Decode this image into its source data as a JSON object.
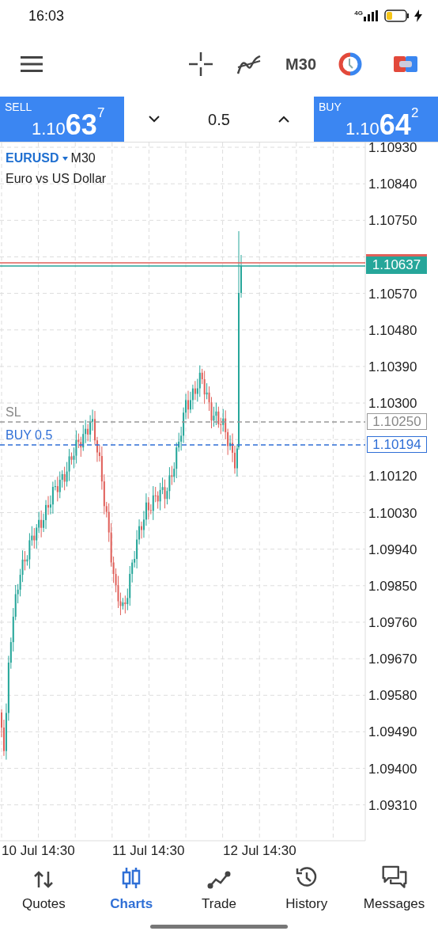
{
  "status_bar": {
    "time": "16:03",
    "network": "4G"
  },
  "toolbar": {
    "timeframe": "M30"
  },
  "trade_panel": {
    "sell": {
      "label": "SELL",
      "price": "1.10**63**$^{7}$"
    },
    "volume": "0.5",
    "buy": {
      "label": "BUY",
      "price": "1.10**64**$^{2}$"
    }
  },
  "chart": {
    "symbol": "EURUSD",
    "timeframe": "M30",
    "description": "Euro vs US Dollar",
    "price_labels": [
      "1.10930",
      "1.10840",
      "1.10750",
      "1.10570",
      "1.10480",
      "1.10390",
      "1.10300",
      "1.10120",
      "1.10030",
      "1.09940",
      "1.09850",
      "1.09760",
      "1.09670",
      "1.09580",
      "1.09490",
      "1.09400",
      "1.09310"
    ],
    "time_labels": [
      "10 Jul 14:30",
      "11 Jul 14:30",
      "12 Jul 14:30"
    ],
    "current_price": "1.10637",
    "levels": [
      {
        "kind": "stop_loss",
        "label": "SL",
        "price": "1.10250"
      },
      {
        "kind": "order",
        "label": "BUY 0.5",
        "price": "1.10194"
      }
    ]
  },
  "nav": [
    {
      "label": "Quotes",
      "selected": false
    },
    {
      "label": "Charts",
      "selected": true
    },
    {
      "label": "Trade",
      "selected": false
    },
    {
      "label": "History",
      "selected": false
    },
    {
      "label": "Messages",
      "selected": false
    }
  ]
}
